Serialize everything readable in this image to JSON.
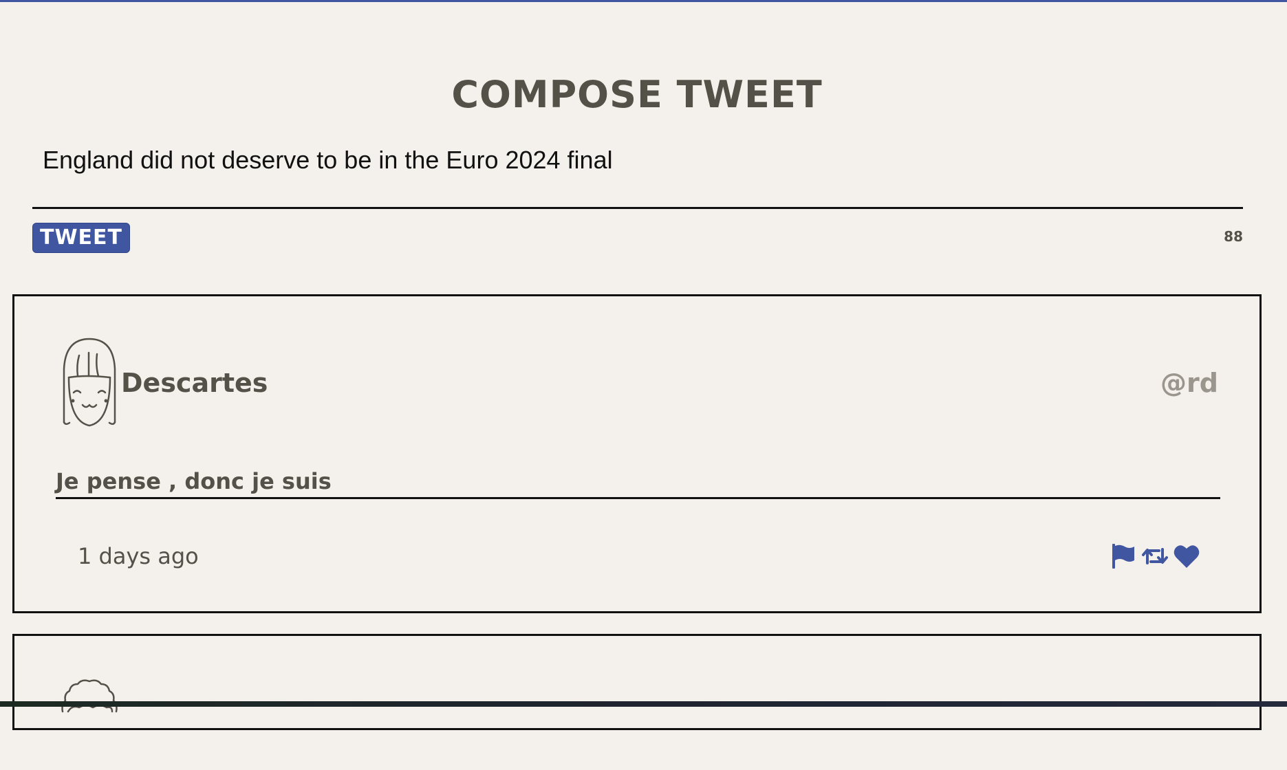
{
  "compose": {
    "title": "Compose Tweet",
    "text_value": "England did not deserve to be in the Euro 2024 final",
    "button_label": "Tweet",
    "char_count": "88"
  },
  "colors": {
    "accent": "#4056a1",
    "background": "#f4f1ec",
    "text": "#545149",
    "handle": "#9a958d"
  },
  "tweets": [
    {
      "avatar_icon": "girl-avatar-icon",
      "name": "Descartes",
      "handle": "@rd",
      "content": "Je pense , donc je suis",
      "time": "1 days ago",
      "actions": [
        "flag-icon",
        "retweet-icon",
        "heart-icon"
      ]
    },
    {
      "avatar_icon": "curly-hair-avatar-icon"
    }
  ]
}
